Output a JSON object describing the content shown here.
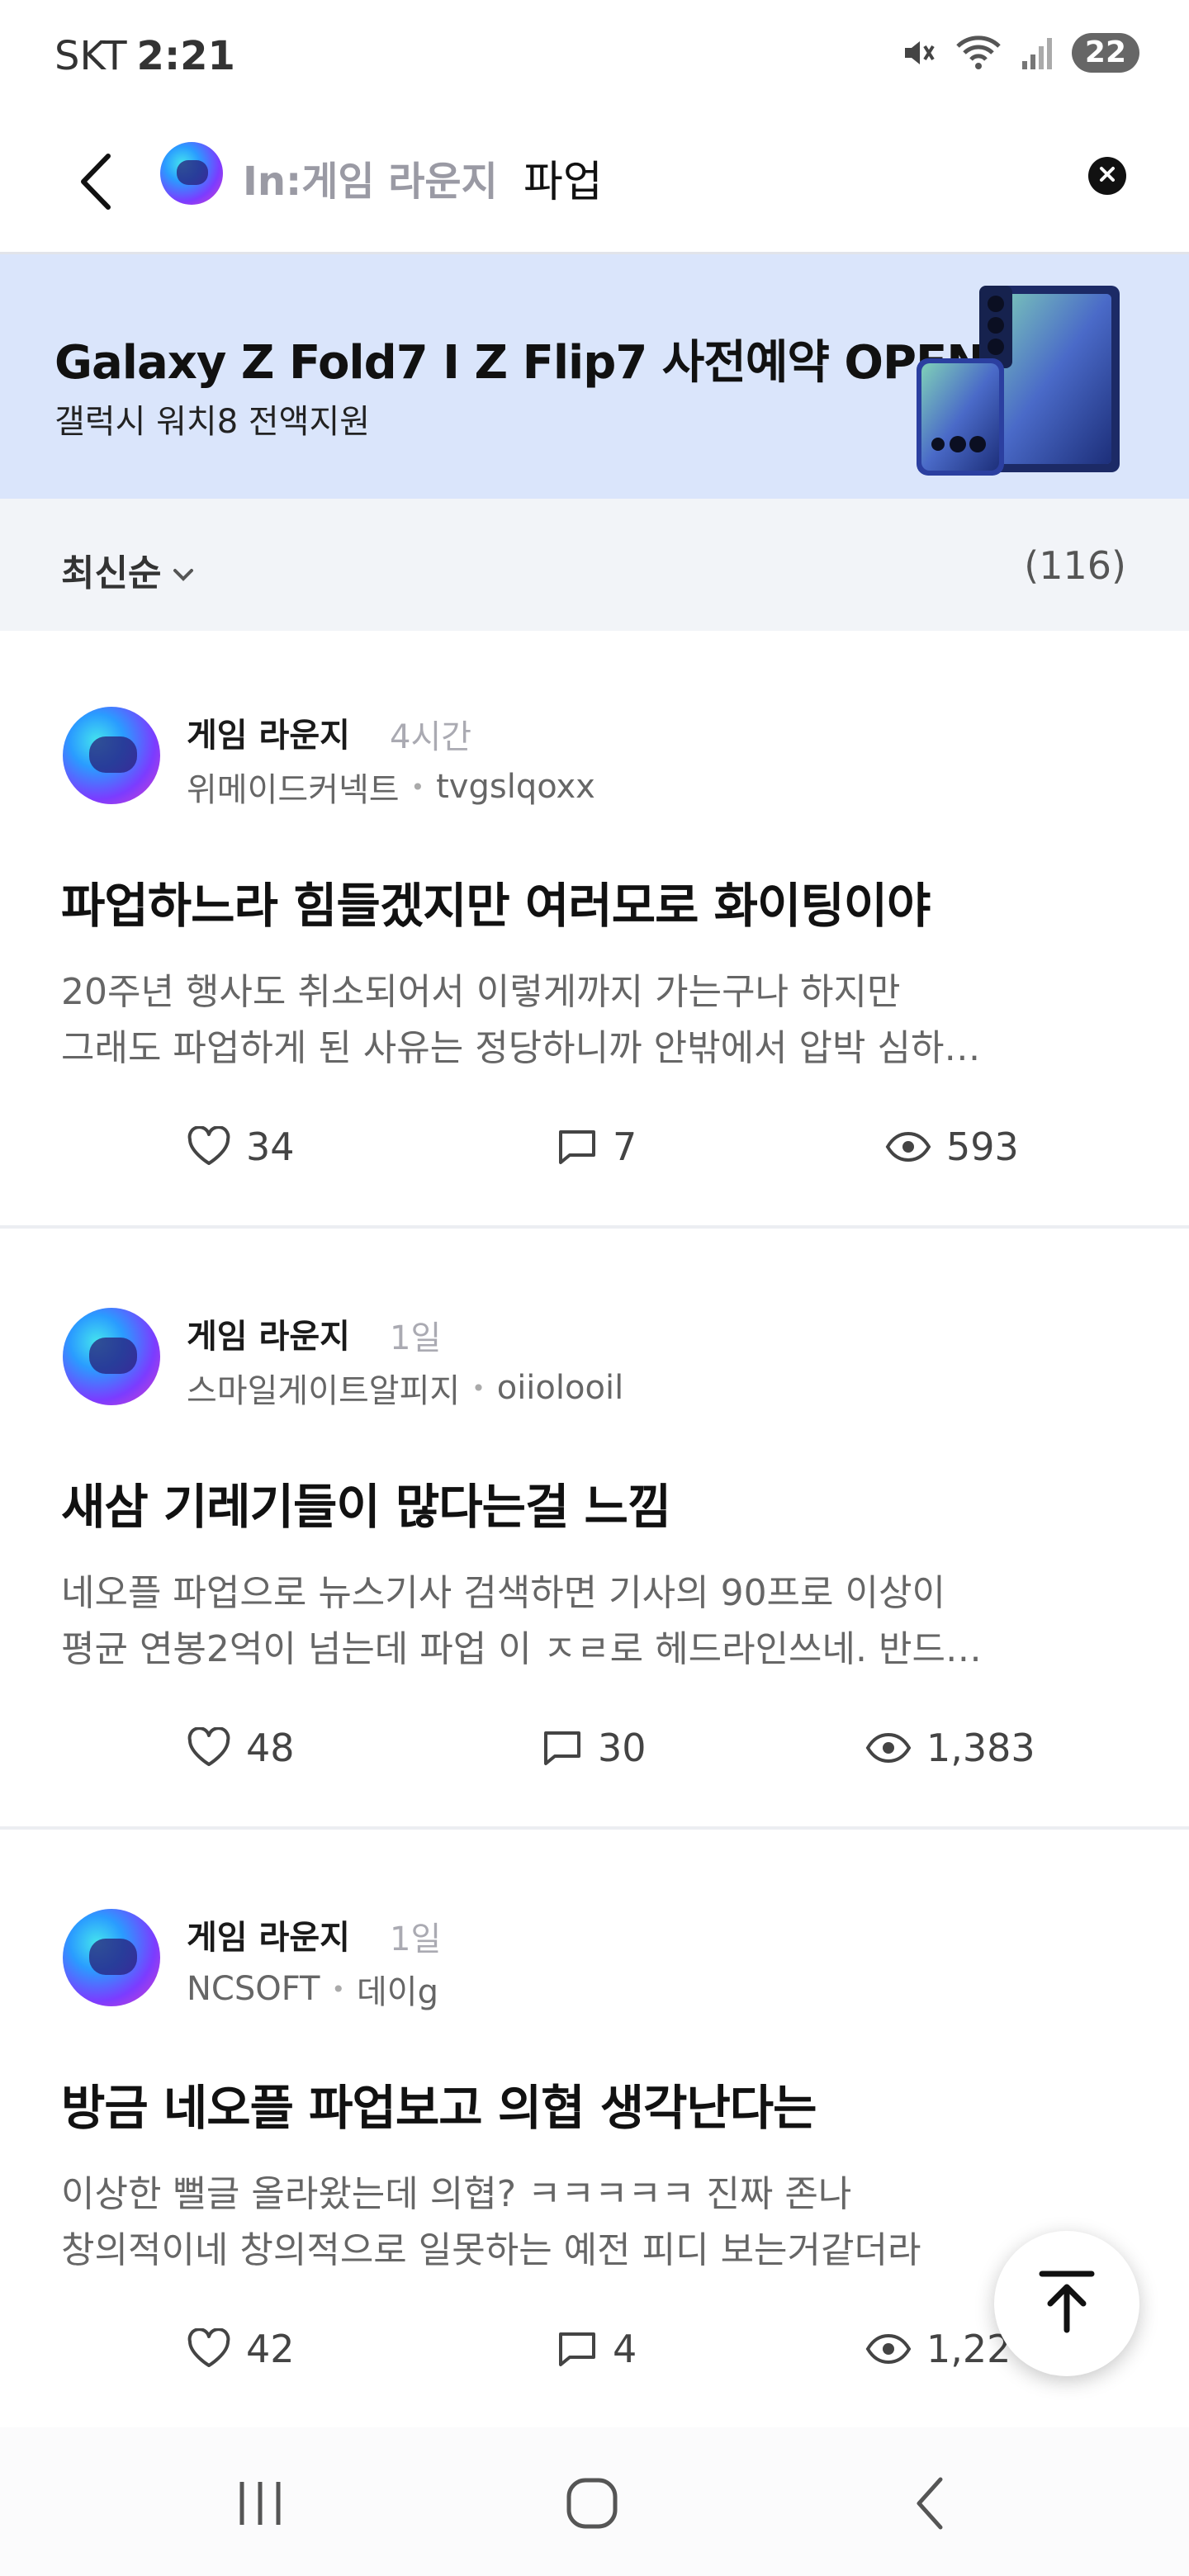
{
  "status_bar": {
    "carrier": "SKT",
    "time": "2:21",
    "battery": "22"
  },
  "search": {
    "scope": "In:게임 라운지",
    "query": "파업"
  },
  "ad": {
    "title": "Galaxy Z Fold7 I Z Flip7 사전예약 OPEN",
    "subtitle": "갤럭시 워치8 전액지원"
  },
  "sort": {
    "label": "최신순",
    "count": "(116)"
  },
  "posts": [
    {
      "community": "게임 라운지",
      "time": "4시간",
      "company": "위메이드커넥트",
      "author": "tvgslqoxx",
      "title": "파업하느라 힘들겠지만 여러모로 화이팅이야",
      "excerpt_line1": "20주년 행사도 취소되어서 이렇게까지 가는구나 하지만",
      "excerpt_line2": "그래도 파업하게 된 사유는 정당하니까  안밖에서 압박 심하…",
      "likes": "34",
      "comments": "7",
      "views": "593"
    },
    {
      "community": "게임 라운지",
      "time": "1일",
      "company": "스마일게이트알피지",
      "author": "oiiolooil",
      "title": "새삼 기레기들이 많다는걸 느낌",
      "excerpt_line1": "네오플 파업으로 뉴스기사 검색하면 기사의 90프로 이상이",
      "excerpt_line2": "평균 연봉2억이 넘는데 파업 이 ㅈㄹ로 헤드라인쓰네.  반드…",
      "likes": "48",
      "comments": "30",
      "views": "1,383"
    },
    {
      "community": "게임 라운지",
      "time": "1일",
      "company": "NCSOFT",
      "author": "데이g",
      "title": "방금 네오플 파업보고 의협 생각난다는",
      "excerpt_line1": "이상한 뻘글 올라왔는데 의협? ㅋㅋㅋㅋㅋ 진짜 존나",
      "excerpt_line2": "창의적이네 창의적으로 일못하는 예전 피디 보는거같더라",
      "likes": "42",
      "comments": "4",
      "views": "1,22"
    }
  ],
  "icons": {
    "back": "back-arrow-icon",
    "clear": "clear-circle-icon",
    "like": "heart-icon",
    "comment": "comment-icon",
    "view": "eye-icon",
    "scroll_top": "arrow-up-to-top-icon"
  }
}
